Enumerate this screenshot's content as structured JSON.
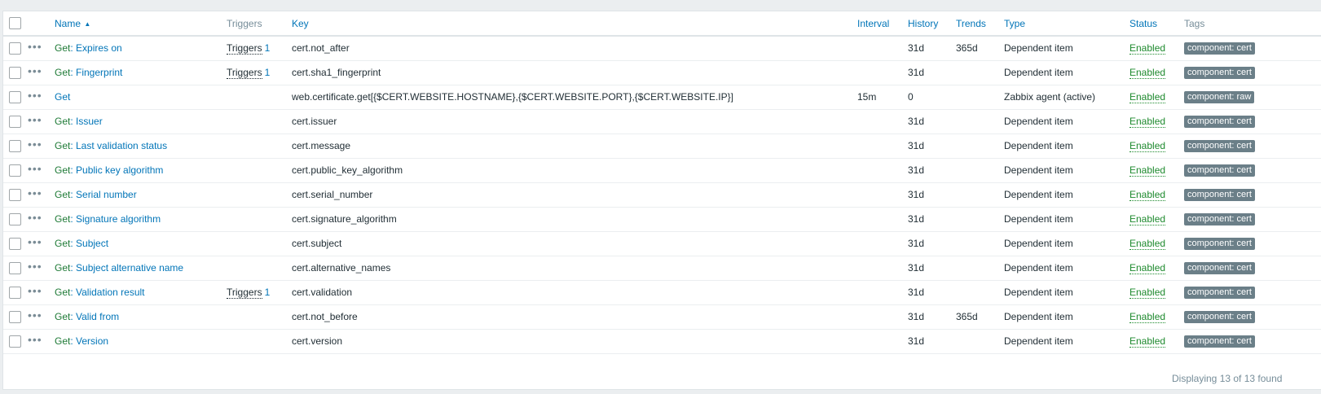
{
  "headers": {
    "name": "Name",
    "sort_arrow": "▲",
    "triggers": "Triggers",
    "key": "Key",
    "interval": "Interval",
    "history": "History",
    "trends": "Trends",
    "type": "Type",
    "status": "Status",
    "tags": "Tags"
  },
  "trigger_label": "Triggers",
  "rows": [
    {
      "prefix": "Get",
      "name": ": Expires on",
      "triggers": "1",
      "key": "cert.not_after",
      "interval": "",
      "history": "31d",
      "trends": "365d",
      "type": "Dependent item",
      "status": "Enabled",
      "tag": "component: cert"
    },
    {
      "prefix": "Get",
      "name": ": Fingerprint",
      "triggers": "1",
      "key": "cert.sha1_fingerprint",
      "interval": "",
      "history": "31d",
      "trends": "",
      "type": "Dependent item",
      "status": "Enabled",
      "tag": "component: cert"
    },
    {
      "prefix": "",
      "name": "Get",
      "triggers": "",
      "key": "web.certificate.get[{$CERT.WEBSITE.HOSTNAME},{$CERT.WEBSITE.PORT},{$CERT.WEBSITE.IP}]",
      "interval": "15m",
      "history": "0",
      "trends": "",
      "type": "Zabbix agent (active)",
      "status": "Enabled",
      "tag": "component: raw"
    },
    {
      "prefix": "Get",
      "name": ": Issuer",
      "triggers": "",
      "key": "cert.issuer",
      "interval": "",
      "history": "31d",
      "trends": "",
      "type": "Dependent item",
      "status": "Enabled",
      "tag": "component: cert"
    },
    {
      "prefix": "Get",
      "name": ": Last validation status",
      "triggers": "",
      "key": "cert.message",
      "interval": "",
      "history": "31d",
      "trends": "",
      "type": "Dependent item",
      "status": "Enabled",
      "tag": "component: cert"
    },
    {
      "prefix": "Get",
      "name": ": Public key algorithm",
      "triggers": "",
      "key": "cert.public_key_algorithm",
      "interval": "",
      "history": "31d",
      "trends": "",
      "type": "Dependent item",
      "status": "Enabled",
      "tag": "component: cert"
    },
    {
      "prefix": "Get",
      "name": ": Serial number",
      "triggers": "",
      "key": "cert.serial_number",
      "interval": "",
      "history": "31d",
      "trends": "",
      "type": "Dependent item",
      "status": "Enabled",
      "tag": "component: cert"
    },
    {
      "prefix": "Get",
      "name": ": Signature algorithm",
      "triggers": "",
      "key": "cert.signature_algorithm",
      "interval": "",
      "history": "31d",
      "trends": "",
      "type": "Dependent item",
      "status": "Enabled",
      "tag": "component: cert"
    },
    {
      "prefix": "Get",
      "name": ": Subject",
      "triggers": "",
      "key": "cert.subject",
      "interval": "",
      "history": "31d",
      "trends": "",
      "type": "Dependent item",
      "status": "Enabled",
      "tag": "component: cert"
    },
    {
      "prefix": "Get",
      "name": ": Subject alternative name",
      "triggers": "",
      "key": "cert.alternative_names",
      "interval": "",
      "history": "31d",
      "trends": "",
      "type": "Dependent item",
      "status": "Enabled",
      "tag": "component: cert"
    },
    {
      "prefix": "Get",
      "name": ": Validation result",
      "triggers": "1",
      "key": "cert.validation",
      "interval": "",
      "history": "31d",
      "trends": "",
      "type": "Dependent item",
      "status": "Enabled",
      "tag": "component: cert"
    },
    {
      "prefix": "Get",
      "name": ": Valid from",
      "triggers": "",
      "key": "cert.not_before",
      "interval": "",
      "history": "31d",
      "trends": "365d",
      "type": "Dependent item",
      "status": "Enabled",
      "tag": "component: cert"
    },
    {
      "prefix": "Get",
      "name": ": Version",
      "triggers": "",
      "key": "cert.version",
      "interval": "",
      "history": "31d",
      "trends": "",
      "type": "Dependent item",
      "status": "Enabled",
      "tag": "component: cert"
    }
  ],
  "footer": "Displaying 13 of 13 found",
  "icons": {
    "more": "more-horizontal-icon",
    "sort": "sort-ascending-icon"
  }
}
